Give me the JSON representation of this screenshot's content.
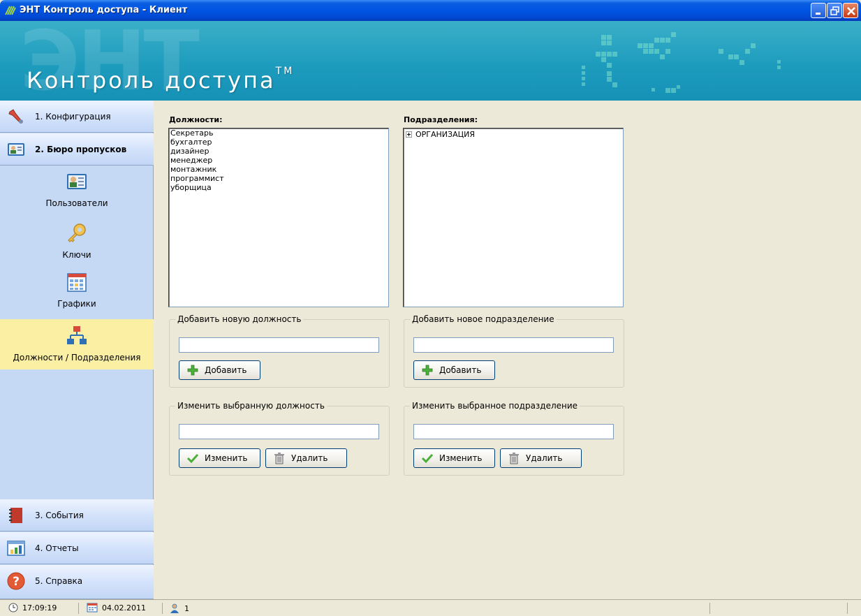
{
  "window": {
    "title": "ЭНТ Контроль доступа - Клиент"
  },
  "banner": {
    "watermark": "ЭНТ",
    "logo_text": "Контроль доступа",
    "trademark": "TM"
  },
  "sidebar": {
    "nav": [
      {
        "label": "1. Конфигурация",
        "icon": "wrench-icon"
      },
      {
        "label": "2. Бюро пропусков",
        "icon": "id-card-icon",
        "active": true
      },
      {
        "label": "3. События",
        "icon": "journal-icon"
      },
      {
        "label": "4. Отчеты",
        "icon": "bar-chart-icon"
      },
      {
        "label": "5. Справка",
        "icon": "help-icon"
      }
    ],
    "sub_items": [
      {
        "label": "Пользователи",
        "icon": "users-card-icon"
      },
      {
        "label": "Ключи",
        "icon": "key-icon"
      },
      {
        "label": "Графики",
        "icon": "calendar-grid-icon"
      },
      {
        "label": "Должности / Подразделения",
        "icon": "org-chart-icon",
        "selected": true
      }
    ]
  },
  "positions": {
    "label": "Должности:",
    "items": [
      "Секретарь",
      "бухгалтер",
      "дизайнер",
      "менеджер",
      "монтажник",
      "программист",
      "уборщица"
    ],
    "add_group": {
      "legend": "Добавить новую должность",
      "value": "",
      "add_button": "Добавить"
    },
    "edit_group": {
      "legend": "Изменить выбранную должность",
      "value": "",
      "edit_button": "Изменить",
      "delete_button": "Удалить"
    }
  },
  "departments": {
    "label": "Подразделения:",
    "tree": [
      {
        "label": "ОРГАНИЗАЦИЯ",
        "collapsed": true
      }
    ],
    "add_group": {
      "legend": "Добавить новое подразделение",
      "value": "",
      "add_button": "Добавить"
    },
    "edit_group": {
      "legend": "Изменить выбранное подразделение",
      "value": "",
      "edit_button": "Изменить",
      "delete_button": "Удалить"
    }
  },
  "statusbar": {
    "time": "17:09:19",
    "date": "04.02.2011",
    "users": "1"
  },
  "colors": {
    "titlebar": "#0054E3",
    "banner": "#1E9CBD",
    "sidebar": "#C5D8F4",
    "selected_item": "#FBEFA3",
    "content_bg": "#ECE9D8"
  }
}
